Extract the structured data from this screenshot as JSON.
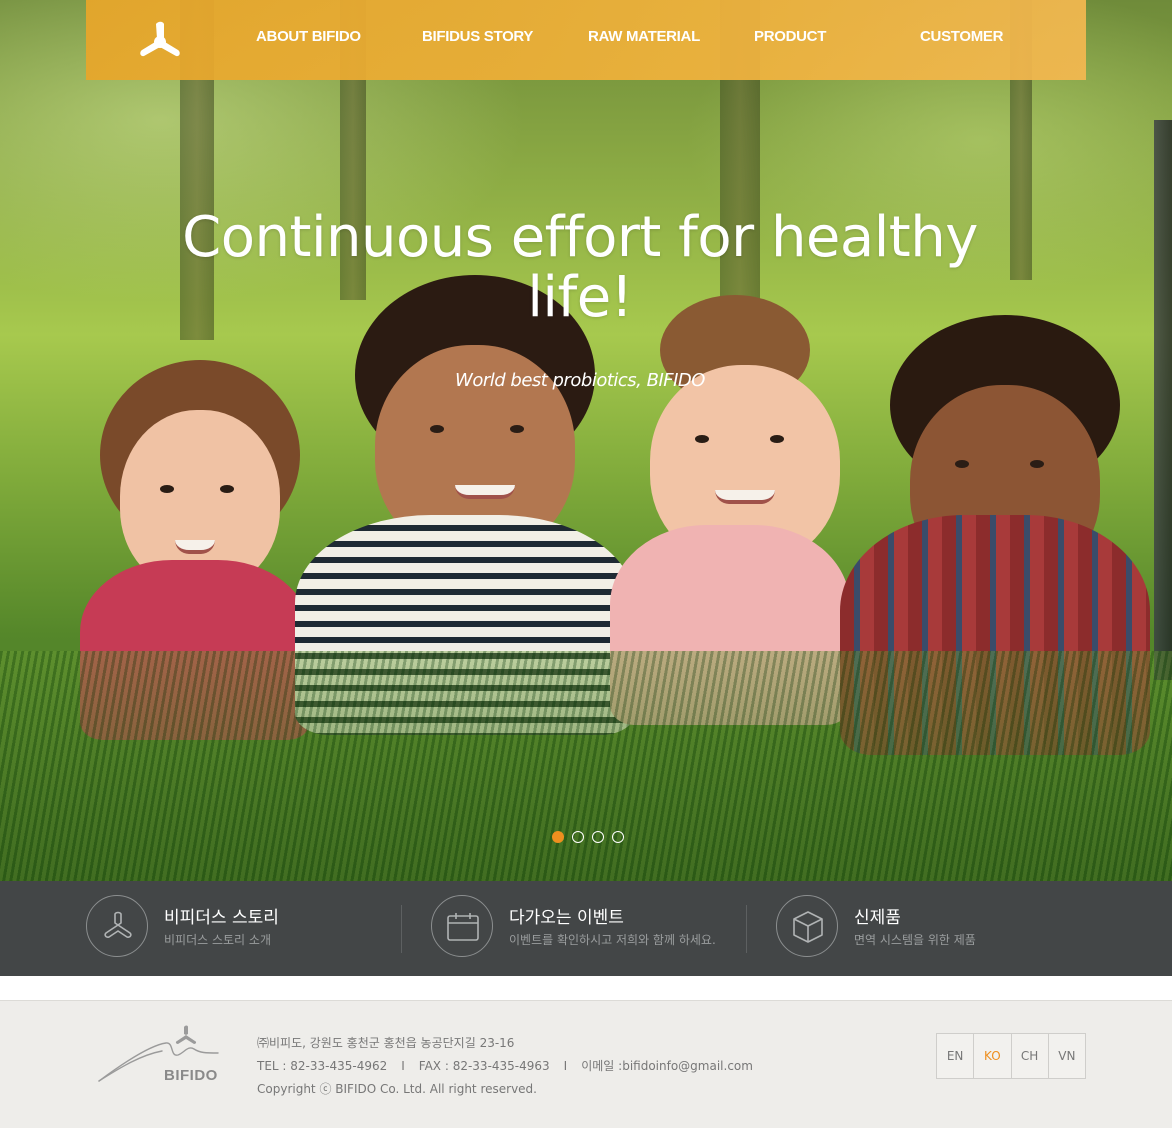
{
  "nav": {
    "items": [
      {
        "label": "ABOUT BIFIDO"
      },
      {
        "label": "BIFIDUS STORY"
      },
      {
        "label": "RAW MATERIAL"
      },
      {
        "label": "PRODUCT"
      },
      {
        "label": "CUSTOMER"
      }
    ]
  },
  "hero": {
    "title": "Continuous effort for healthy life!",
    "subtitle": "World best probiotics, BIFIDO",
    "slide_count": 4,
    "active_slide": 1
  },
  "info": [
    {
      "title": "비피더스 스토리",
      "desc": "비피더스 스토리 소개",
      "icon": "bifido-logo-icon"
    },
    {
      "title": "다가오는 이벤트",
      "desc": "이벤트를 확인하시고 저희와 함께 하세요.",
      "icon": "calendar-icon"
    },
    {
      "title": "신제품",
      "desc": "면역 시스템을 위한 제품",
      "icon": "box-icon"
    }
  ],
  "footer": {
    "logo_text": "BIFIDO",
    "address": "㈜비피도, 강원도 홍천군 홍천읍 농공단지길 23-16",
    "tel": "TEL : 82-33-435-4962",
    "fax": "FAX : 82-33-435-4963",
    "email": "이메일 :bifidoinfo@gmail.com",
    "separator": "I",
    "copyright": "Copyright ⓒ BIFIDO Co. Ltd. All right reserved.",
    "languages": [
      "EN",
      "KO",
      "CH",
      "VN"
    ],
    "active_language": "KO"
  },
  "colors": {
    "accent": "#ee8f1f",
    "nav_bg": "#eba83a",
    "info_bg": "#434647",
    "footer_bg": "#eeedea"
  }
}
